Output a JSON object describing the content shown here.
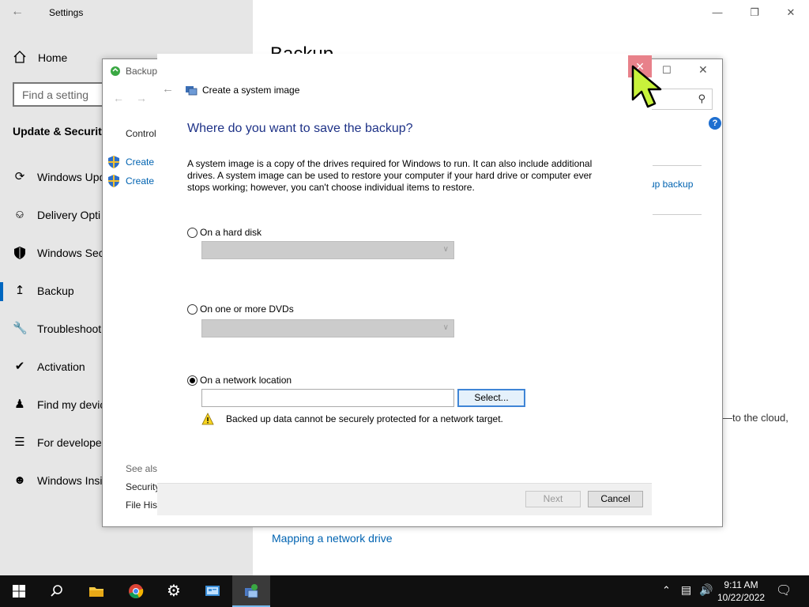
{
  "settings": {
    "title": "Settings",
    "home": "Home",
    "search_placeholder": "Find a setting",
    "section": "Update & Security",
    "nav": [
      {
        "label": "Windows Upd",
        "icon": "refresh-icon"
      },
      {
        "label": "Delivery Opti",
        "icon": "delivery-icon"
      },
      {
        "label": "Windows Sec",
        "icon": "shield-icon"
      },
      {
        "label": "Backup",
        "icon": "backup-icon"
      },
      {
        "label": "Troubleshoot",
        "icon": "wrench-icon"
      },
      {
        "label": "Activation",
        "icon": "check-circle-icon"
      },
      {
        "label": "Find my devic",
        "icon": "person-icon"
      },
      {
        "label": "For developer",
        "icon": "developer-icon"
      },
      {
        "label": "Windows Insi",
        "icon": "insider-icon"
      }
    ],
    "active_item": "Backup",
    "main": {
      "page_title": "Backup",
      "link_backup": "up backup",
      "cloud_text": "—to the cloud,",
      "mapping_link": "Mapping a network drive"
    }
  },
  "control_panel": {
    "title": "Backup",
    "breadcrumb": "Control",
    "links": [
      "Create a",
      "Create a"
    ],
    "see_also": "See also",
    "see_also_items": [
      "Security",
      "File His"
    ],
    "help": "?"
  },
  "wizard": {
    "title": "Create a system image",
    "heading": "Where do you want to save the backup?",
    "description": "A system image is a copy of the drives required for Windows to run. It can also include additional drives. A system image can be used to restore your computer if your hard drive or computer ever stops working; however, you can't choose individual items to restore.",
    "options": {
      "hard_disk": "On a hard disk",
      "dvds": "On one or more DVDs",
      "network": "On a network location"
    },
    "selected_option": "network",
    "network_path_value": "",
    "select_button": "Select...",
    "warning": "Backed up data cannot be securely protected for a network target.",
    "next_button": "Next",
    "cancel_button": "Cancel"
  },
  "taskbar": {
    "time": "9:11 AM",
    "date": "10/22/2022",
    "apps": [
      "start-icon",
      "search-icon",
      "file-explorer-icon",
      "chrome-icon",
      "settings-gear-icon",
      "control-panel-icon",
      "backup-app-icon"
    ]
  },
  "colors": {
    "accent": "#0067c0",
    "link": "#0063b1",
    "heading_blue": "#1e3287",
    "close_hover": "#e8818a",
    "cursor": "#c8f23b"
  }
}
